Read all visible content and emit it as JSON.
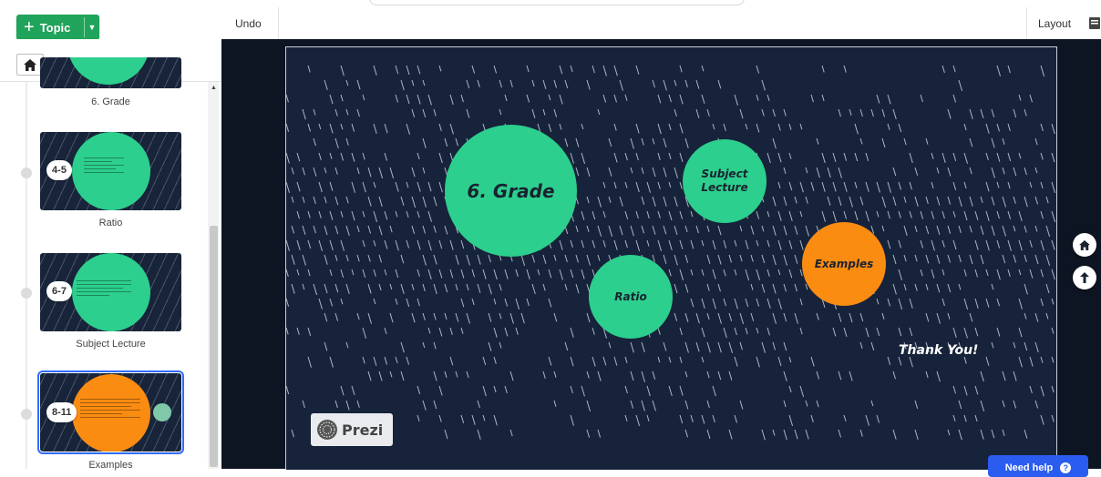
{
  "toolbar": {
    "add_topic_label": "Topic",
    "undo_label": "Undo",
    "layout_label": "Layout"
  },
  "sidebar": {
    "slides": [
      {
        "label": "6. Grade",
        "badge": "",
        "circle_color": "#2ccf8d"
      },
      {
        "label": "Ratio",
        "badge": "4-5",
        "circle_color": "#2ccf8d"
      },
      {
        "label": "Subject Lecture",
        "badge": "6-7",
        "circle_color": "#2ccf8d"
      },
      {
        "label": "Examples",
        "badge": "8-11",
        "circle_color": "#fb8c12",
        "selected": true
      }
    ]
  },
  "canvas": {
    "nodes": [
      {
        "id": "grade",
        "label": "6. Grade",
        "color": "#2ccf8d"
      },
      {
        "id": "subject",
        "label": "Subject Lecture",
        "color": "#2ccf8d"
      },
      {
        "id": "examples",
        "label": "Examples",
        "color": "#fb8c12"
      },
      {
        "id": "ratio",
        "label": "Ratio",
        "color": "#2ccf8d"
      }
    ],
    "thank_you": "Thank You!",
    "logo_text": "Prezi"
  },
  "help": {
    "label": "Need help"
  },
  "colors": {
    "brand_green": "#20a35a",
    "canvas_bg": "#16233a",
    "accent_blue": "#2b5cf0"
  },
  "icons": [
    "plus-icon",
    "chevron-down-icon",
    "home-icon",
    "layout-icon",
    "back-arrow-icon",
    "help-icon",
    "prezi-logo-icon"
  ]
}
